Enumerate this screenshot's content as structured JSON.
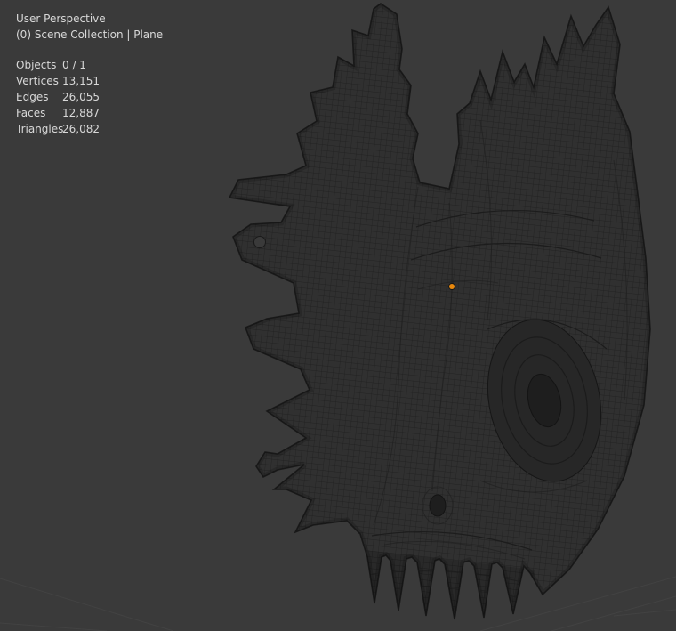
{
  "viewport": {
    "view_label": "User Perspective",
    "collection_label": "(0) Scene Collection | Plane",
    "stats": {
      "rows": [
        {
          "label": "Objects",
          "value": "0 / 1"
        },
        {
          "label": "Vertices",
          "value": "13,151"
        },
        {
          "label": "Edges",
          "value": "26,055"
        },
        {
          "label": "Faces",
          "value": "12,887"
        },
        {
          "label": "Triangles",
          "value": "26,082"
        }
      ]
    },
    "object": {
      "name": "Plane",
      "origin_marker": "origin-dot"
    },
    "colors": {
      "background": "#3a3a3a",
      "text": "#d8d8d8",
      "wireframe": "#1a1a1a",
      "mesh_fill": "#303030",
      "origin": "#e8880d",
      "grid_line": "#474747"
    }
  }
}
